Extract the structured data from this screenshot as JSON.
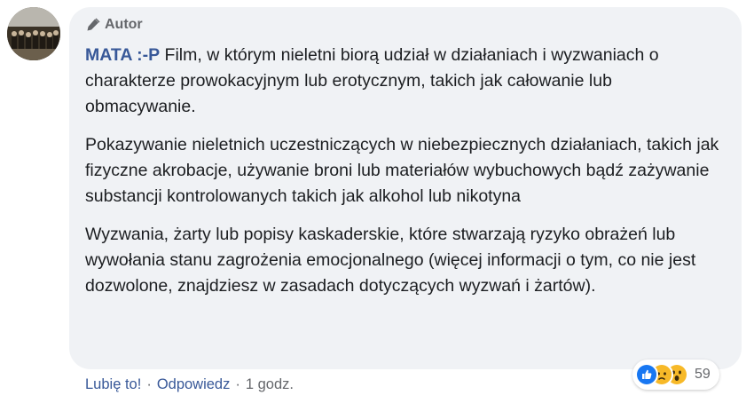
{
  "comment": {
    "author_badge": "Autor",
    "author_name": "MATA :-P",
    "paragraphs": [
      "Film, w którym nieletni biorą udział w działaniach i wyzwaniach o charakterze prowokacyjnym lub erotycznym, takich jak całowanie lub obmacywanie.",
      "Pokazywanie nieletnich uczestniczących w niebezpiecznych działaniach, takich jak fizyczne akrobacje, używanie broni lub materiałów wybuchowych bądź zażywanie substancji kontrolowanych takich jak alkohol lub nikotyna",
      "Wyzwania, żarty lub popisy kaskaderskie, które stwarzają ryzyko obrażeń lub wywołania stanu zagrożenia emocjonalnego (więcej informacji o tym, co nie jest dozwolone, znajdziesz w zasadach dotyczących wyzwań i żartów)."
    ],
    "reactions": {
      "icons": [
        "like-icon",
        "sad-icon",
        "wow-icon"
      ],
      "count": "59"
    },
    "actions": {
      "like": "Lubię to!",
      "separator": "·",
      "reply": "Odpowiedz",
      "time": "1 godz."
    }
  },
  "colors": {
    "bubble": "#f0f2f5",
    "link": "#385898",
    "text": "#1c1e21",
    "muted": "#65676b",
    "like_blue": "#1877f2",
    "emoji_yellow": "#f7b928"
  }
}
